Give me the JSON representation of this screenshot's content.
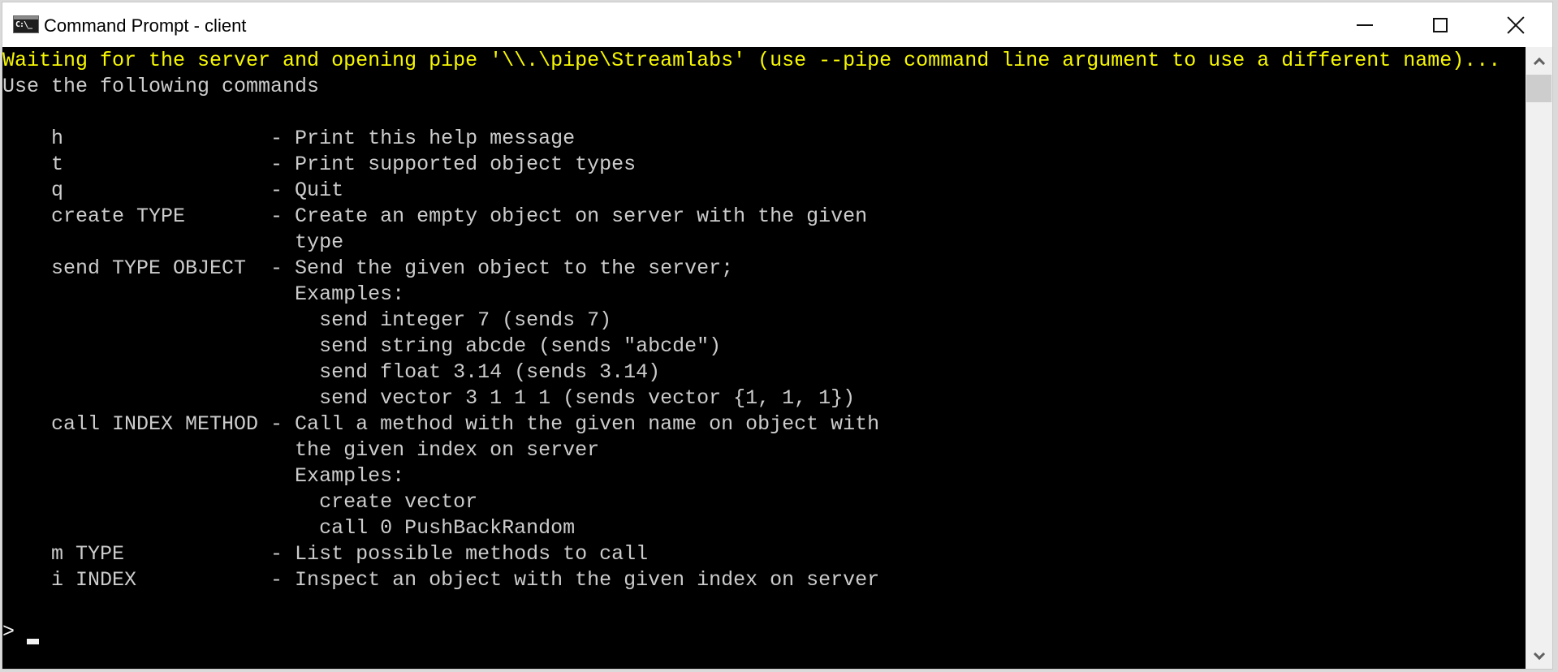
{
  "window": {
    "title": "Command Prompt - client",
    "app_icon_text": "C:\\_",
    "buttons": {
      "minimize": "minimize",
      "maximize": "maximize",
      "close": "close"
    }
  },
  "console": {
    "lines": [
      {
        "text": "Waiting for the server and opening pipe '\\\\.\\pipe\\Streamlabs' (use --pipe command line argument to use a different name)...",
        "style": "warn"
      },
      {
        "text": "Use the following commands",
        "style": "normal"
      },
      {
        "text": "",
        "style": "normal"
      },
      {
        "text": "    h                 - Print this help message",
        "style": "normal"
      },
      {
        "text": "    t                 - Print supported object types",
        "style": "normal"
      },
      {
        "text": "    q                 - Quit",
        "style": "normal"
      },
      {
        "text": "    create TYPE       - Create an empty object on server with the given",
        "style": "normal"
      },
      {
        "text": "                        type",
        "style": "normal"
      },
      {
        "text": "    send TYPE OBJECT  - Send the given object to the server;",
        "style": "normal"
      },
      {
        "text": "                        Examples:",
        "style": "normal"
      },
      {
        "text": "                          send integer 7 (sends 7)",
        "style": "normal"
      },
      {
        "text": "                          send string abcde (sends \"abcde\")",
        "style": "normal"
      },
      {
        "text": "                          send float 3.14 (sends 3.14)",
        "style": "normal"
      },
      {
        "text": "                          send vector 3 1 1 1 (sends vector {1, 1, 1})",
        "style": "normal"
      },
      {
        "text": "    call INDEX METHOD - Call a method with the given name on object with",
        "style": "normal"
      },
      {
        "text": "                        the given index on server",
        "style": "normal"
      },
      {
        "text": "                        Examples:",
        "style": "normal"
      },
      {
        "text": "                          create vector",
        "style": "normal"
      },
      {
        "text": "                          call 0 PushBackRandom",
        "style": "normal"
      },
      {
        "text": "    m TYPE            - List possible methods to call",
        "style": "normal"
      },
      {
        "text": "    i INDEX           - Inspect an object with the given index on server",
        "style": "normal"
      },
      {
        "text": "",
        "style": "normal"
      }
    ],
    "prompt": ">",
    "input_value": "",
    "colors": {
      "background": "#000000",
      "text": "#cccccc",
      "warning": "#f7f700"
    }
  },
  "scrollbar": {
    "up_icon": "chevron-up-icon",
    "down_icon": "chevron-down-icon",
    "position_fraction": 0.0
  }
}
